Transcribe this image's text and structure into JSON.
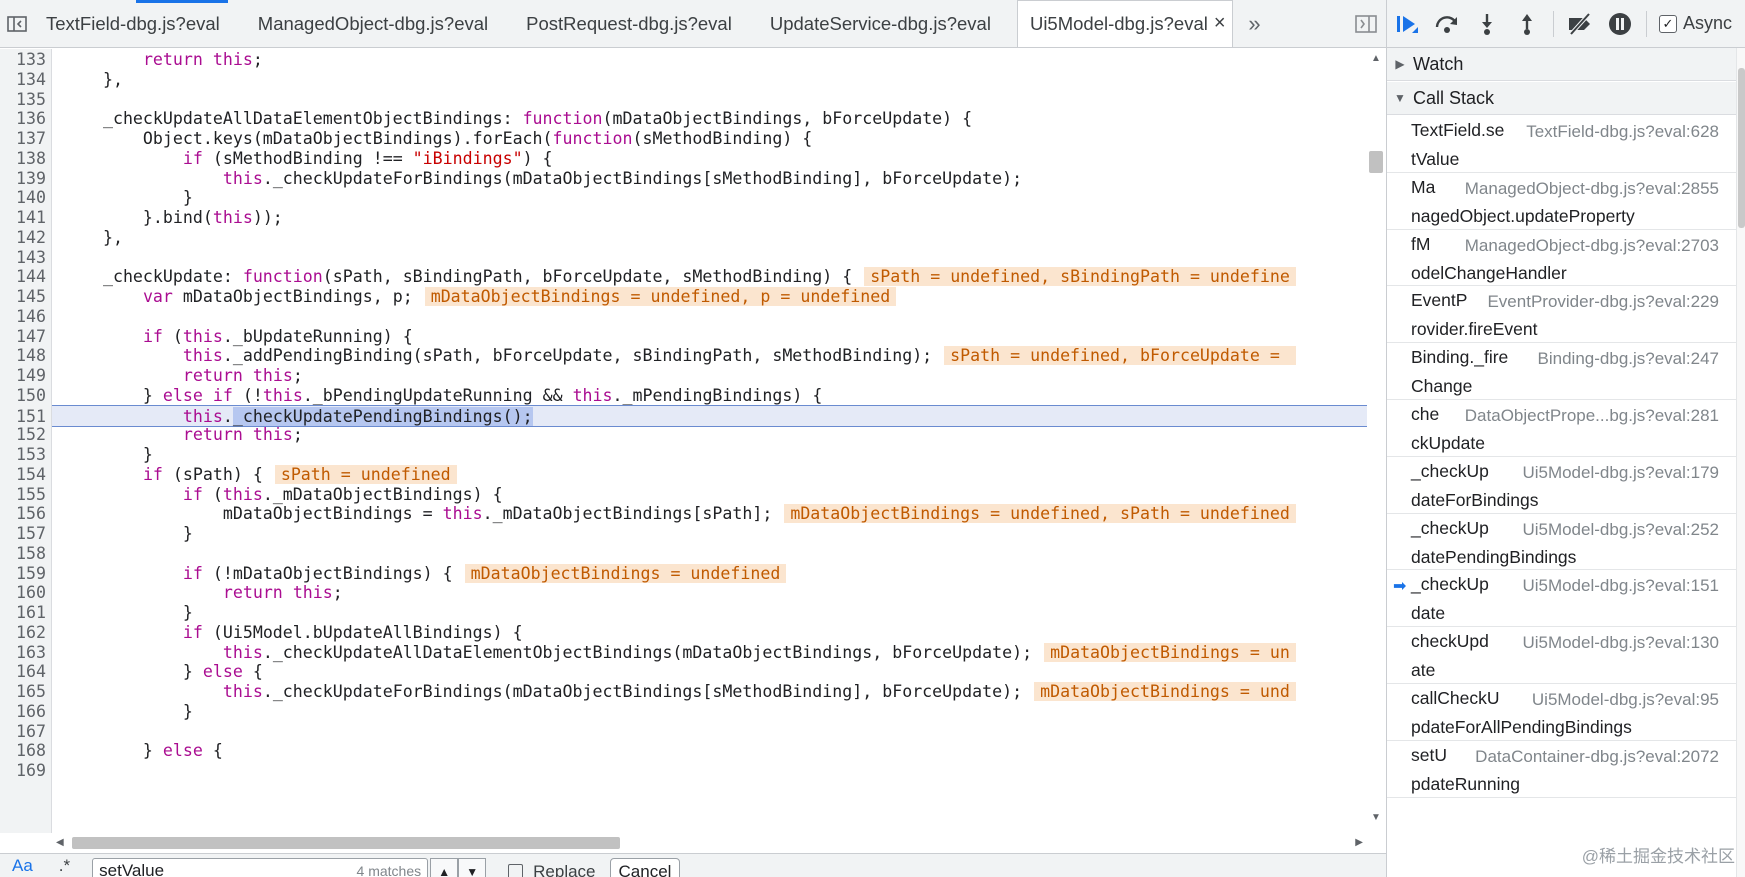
{
  "tabs": [
    {
      "label": "TextField-dbg.js?eval",
      "active": false
    },
    {
      "label": "ManagedObject-dbg.js?eval",
      "active": false
    },
    {
      "label": "PostRequest-dbg.js?eval",
      "active": false
    },
    {
      "label": "UpdateService-dbg.js?eval",
      "active": false
    },
    {
      "label": "Ui5Model-dbg.js?eval",
      "active": true
    }
  ],
  "icons": {
    "toggle_navigator": "sidebar-left-icon",
    "tab_close": "close-icon",
    "more_tabs": "double-chevron-right-icon",
    "toggle_debugger": "sidebar-right-icon"
  },
  "code": {
    "lines": [
      {
        "n": "133",
        "t": "        return this;"
      },
      {
        "n": "134",
        "t": "    },"
      },
      {
        "n": "135",
        "t": ""
      },
      {
        "n": "136",
        "t": "    _checkUpdateAllDataElementObjectBindings: function(mDataObjectBindings, bForceUpdate) {"
      },
      {
        "n": "137",
        "t": "        Object.keys(mDataObjectBindings).forEach(function(sMethodBinding) {"
      },
      {
        "n": "138",
        "t": "            if (sMethodBinding !== \"iBindings\") {"
      },
      {
        "n": "139",
        "t": "                this._checkUpdateForBindings(mDataObjectBindings[sMethodBinding], bForceUpdate);"
      },
      {
        "n": "140",
        "t": "            }"
      },
      {
        "n": "141",
        "t": "        }.bind(this));"
      },
      {
        "n": "142",
        "t": "    },"
      },
      {
        "n": "143",
        "t": ""
      },
      {
        "n": "144",
        "t": "    _checkUpdate: function(sPath, sBindingPath, bForceUpdate, sMethodBinding) {",
        "ann": "sPath = undefined, sBindingPath = undefine"
      },
      {
        "n": "145",
        "t": "        var mDataObjectBindings, p;",
        "ann": "mDataObjectBindings = undefined, p = undefined"
      },
      {
        "n": "146",
        "t": ""
      },
      {
        "n": "147",
        "t": "        if (this._bUpdateRunning) {"
      },
      {
        "n": "148",
        "t": "            this._addPendingBinding(sPath, bForceUpdate, sBindingPath, sMethodBinding);",
        "ann": "sPath = undefined, bForceUpdate = "
      },
      {
        "n": "149",
        "t": "            return this;"
      },
      {
        "n": "150",
        "t": "        } else if (!this._bPendingUpdateRunning && this._mPendingBindings) {"
      },
      {
        "n": "151",
        "t": "            this._checkUpdatePendingBindings();",
        "current": true
      },
      {
        "n": "152",
        "t": "            return this;"
      },
      {
        "n": "153",
        "t": "        }"
      },
      {
        "n": "154",
        "t": "        if (sPath) {",
        "ann": "sPath = undefined"
      },
      {
        "n": "155",
        "t": "            if (this._mDataObjectBindings) {"
      },
      {
        "n": "156",
        "t": "                mDataObjectBindings = this._mDataObjectBindings[sPath];",
        "ann": "mDataObjectBindings = undefined, sPath = undefined"
      },
      {
        "n": "157",
        "t": "            }"
      },
      {
        "n": "158",
        "t": ""
      },
      {
        "n": "159",
        "t": "            if (!mDataObjectBindings) {",
        "ann": "mDataObjectBindings = undefined"
      },
      {
        "n": "160",
        "t": "                return this;"
      },
      {
        "n": "161",
        "t": "            }"
      },
      {
        "n": "162",
        "t": "            if (Ui5Model.bUpdateAllBindings) {"
      },
      {
        "n": "163",
        "t": "                this._checkUpdateAllDataElementObjectBindings(mDataObjectBindings, bForceUpdate);",
        "ann": "mDataObjectBindings = un"
      },
      {
        "n": "164",
        "t": "            } else {"
      },
      {
        "n": "165",
        "t": "                this._checkUpdateForBindings(mDataObjectBindings[sMethodBinding], bForceUpdate);",
        "ann": "mDataObjectBindings = und"
      },
      {
        "n": "166",
        "t": "            }"
      },
      {
        "n": "167",
        "t": ""
      },
      {
        "n": "168",
        "t": "        } else {"
      },
      {
        "n": "169",
        "t": ""
      }
    ]
  },
  "search": {
    "aa": "Aa",
    "star": ".*",
    "value": "setValue",
    "matches": "4 matches",
    "replace_label": "Replace",
    "cancel_label": "Cancel"
  },
  "debugger": {
    "toolbar_icons": [
      "resume-icon",
      "step-over-icon",
      "step-into-icon",
      "step-out-icon",
      "deactivate-breakpoints-icon",
      "pause-on-exceptions-icon"
    ],
    "async_label": "Async",
    "async_checked": true,
    "watch_label": "Watch",
    "call_stack_label": "Call Stack",
    "frames": [
      {
        "fn1": "TextField.se",
        "fn2": "tValue",
        "loc": "TextField-dbg.js?eval:628"
      },
      {
        "fn1": "Ma",
        "fn2": "nagedObject.updateProperty",
        "loc": "ManagedObject-dbg.js?eval:2855"
      },
      {
        "fn1": "fM",
        "fn2": "odelChangeHandler",
        "loc": "ManagedObject-dbg.js?eval:2703"
      },
      {
        "fn1": "EventP",
        "fn2": "rovider.fireEvent",
        "loc": "EventProvider-dbg.js?eval:229"
      },
      {
        "fn1": "Binding._fire",
        "fn2": "Change",
        "loc": "Binding-dbg.js?eval:247"
      },
      {
        "fn1": "che",
        "fn2": "ckUpdate",
        "loc": "DataObjectPrope...bg.js?eval:281"
      },
      {
        "fn1": "_checkUp",
        "fn2": "dateForBindings",
        "loc": "Ui5Model-dbg.js?eval:179"
      },
      {
        "fn1": "_checkUp",
        "fn2": "datePendingBindings",
        "loc": "Ui5Model-dbg.js?eval:252"
      },
      {
        "fn1": "_checkUp",
        "fn2": "date",
        "loc": "Ui5Model-dbg.js?eval:151",
        "current": true
      },
      {
        "fn1": "checkUpd",
        "fn2": "ate",
        "loc": "Ui5Model-dbg.js?eval:130"
      },
      {
        "fn1": "callCheckU",
        "fn2": "pdateForAllPendingBindings",
        "loc": "Ui5Model-dbg.js?eval:95"
      },
      {
        "fn1": "setU",
        "fn2": "pdateRunning",
        "loc": "DataContainer-dbg.js?eval:2072"
      }
    ]
  },
  "watermark": "@稀土掘金技术社区",
  "colors": {
    "accent": "#1a73e8",
    "current_line_bg": "#e5eaf7",
    "annotation_bg": "#fbe5cf",
    "annotation_text": "#c05a00",
    "keyword": "#aa0d91",
    "string": "#c80000"
  }
}
